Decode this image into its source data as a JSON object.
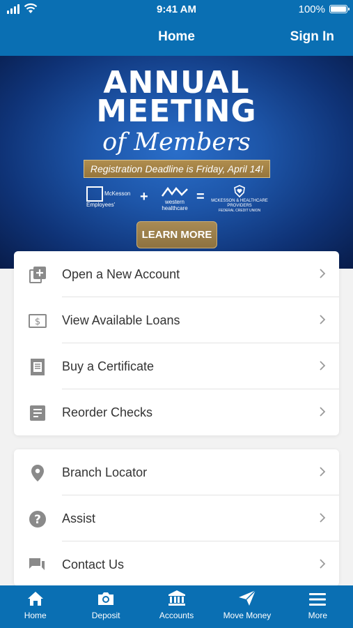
{
  "status_bar": {
    "time": "9:41 AM",
    "battery": "100%"
  },
  "nav": {
    "title": "Home",
    "sign_in": "Sign In"
  },
  "banner": {
    "line1": "ANNUAL",
    "line2": "MEETING",
    "line3": "of Members",
    "deadline": "Registration Deadline is Friday, April 14!",
    "logo1_text": "McKesson Employees'",
    "logo2_text": "western healthcare",
    "logo3_text": "MCKESSON & HEALTHCARE PROVIDERS",
    "logo3_sub": "FEDERAL CREDIT UNION",
    "plus": "+",
    "equals": "=",
    "cta": "LEARN MORE"
  },
  "menu_primary": [
    {
      "label": "Open a New Account",
      "icon": "add-box-icon"
    },
    {
      "label": "View Available Loans",
      "icon": "dollar-bill-icon"
    },
    {
      "label": "Buy a Certificate",
      "icon": "certificate-icon"
    },
    {
      "label": "Reorder Checks",
      "icon": "document-icon"
    }
  ],
  "menu_secondary": [
    {
      "label": "Branch Locator",
      "icon": "location-pin-icon"
    },
    {
      "label": "Assist",
      "icon": "help-circle-icon"
    },
    {
      "label": "Contact Us",
      "icon": "chat-icon"
    }
  ],
  "tabs": [
    {
      "label": "Home",
      "icon": "home-icon"
    },
    {
      "label": "Deposit",
      "icon": "camera-icon"
    },
    {
      "label": "Accounts",
      "icon": "bank-icon"
    },
    {
      "label": "Move Money",
      "icon": "paper-plane-icon"
    },
    {
      "label": "More",
      "icon": "menu-icon"
    }
  ],
  "colors": {
    "brand": "#0a6fb3",
    "gold": "#a88b55",
    "icon_gray": "#8a8a8a",
    "text": "#333333"
  }
}
